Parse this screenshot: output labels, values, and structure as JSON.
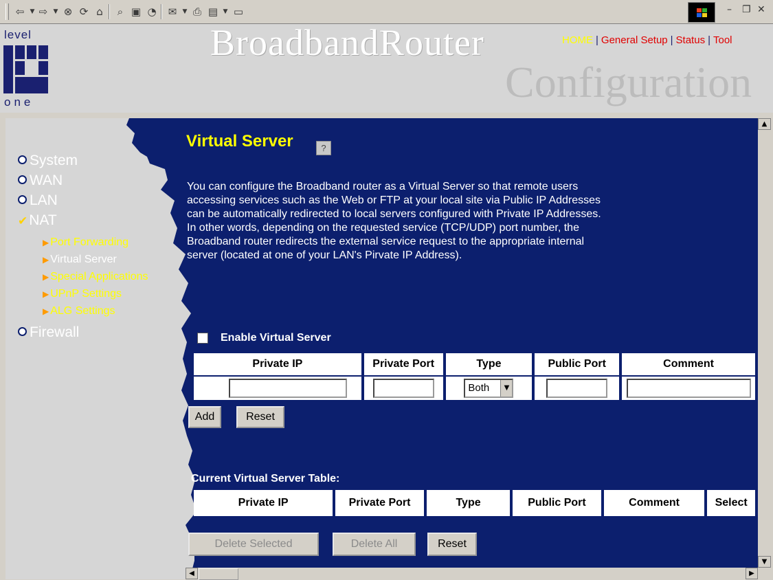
{
  "toolbar": {
    "icons": [
      "back-icon",
      "dropdown-icon",
      "forward-icon",
      "dropdown-icon",
      "stop-icon",
      "refresh-icon",
      "home-icon",
      "search-icon",
      "favorites-icon",
      "history-icon",
      "mail-icon",
      "print-icon",
      "edit-icon",
      "discuss-icon"
    ]
  },
  "header": {
    "logo_top": "level",
    "logo_bottom": "one",
    "brand": "BroadbandRouter",
    "subtitle": "Configuration",
    "nav": {
      "home": "HOME",
      "general_setup": "General Setup",
      "status": "Status",
      "tool": "Tool"
    }
  },
  "sidebar": {
    "items": [
      {
        "label": "System"
      },
      {
        "label": "WAN"
      },
      {
        "label": "LAN"
      },
      {
        "label": "NAT"
      },
      {
        "label": "Firewall"
      }
    ],
    "nat_sub": [
      {
        "label": "Port Forwarding"
      },
      {
        "label": "Virtual Server"
      },
      {
        "label": "Special Applications"
      },
      {
        "label": "UPnP Settings"
      },
      {
        "label": "ALG Settings"
      }
    ]
  },
  "page": {
    "title": "Virtual Server",
    "description": "You can configure the Broadband router as a Virtual Server so that remote users\naccessing services such as the Web or FTP at your local site via Public IP Addresses\ncan be automatically redirected to local servers configured with Private IP Addresses.\nIn other words, depending on the requested service (TCP/UDP) port number, the\nBroadband router redirects the external service request to the appropriate internal\nserver (located at one of your LAN's Pirvate IP Address).",
    "enable_label": "Enable Virtual Server"
  },
  "form": {
    "headers": [
      "Private IP",
      "Private Port",
      "Type",
      "Public Port",
      "Comment"
    ],
    "type_value": "Both",
    "add_label": "Add",
    "reset_label": "Reset"
  },
  "current_table": {
    "title_pre": "Current Virtual Server Table:",
    "headers": [
      "Private IP",
      "Private Port",
      "Type",
      "Public Port",
      "Comment",
      "Select"
    ],
    "delete_selected_label": "Delete Selected",
    "delete_all_label": "Delete All",
    "reset_label": "Reset"
  }
}
